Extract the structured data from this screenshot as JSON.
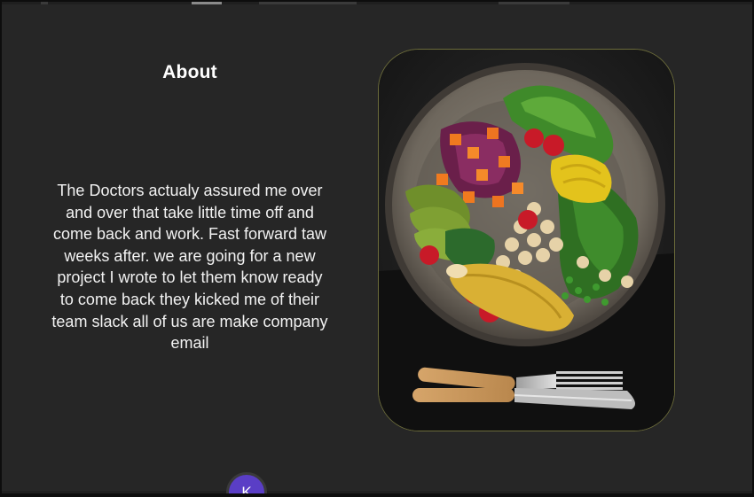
{
  "about": {
    "title": "About",
    "body": "The Doctors actualy assured me over and over that take little time off and come back and work. Fast forward taw weeks after. we are going for a new project I wrote to let them know ready to come back they kicked me of their team slack all of us are make company email"
  },
  "image": {
    "subject": "salad-bowl-with-fork-and-knife"
  },
  "avatar": {
    "initial": "K",
    "color": "#5a3ec6"
  },
  "colors": {
    "background": "#262626",
    "frame_border": "#6b6b3a",
    "text": "#ffffff"
  }
}
